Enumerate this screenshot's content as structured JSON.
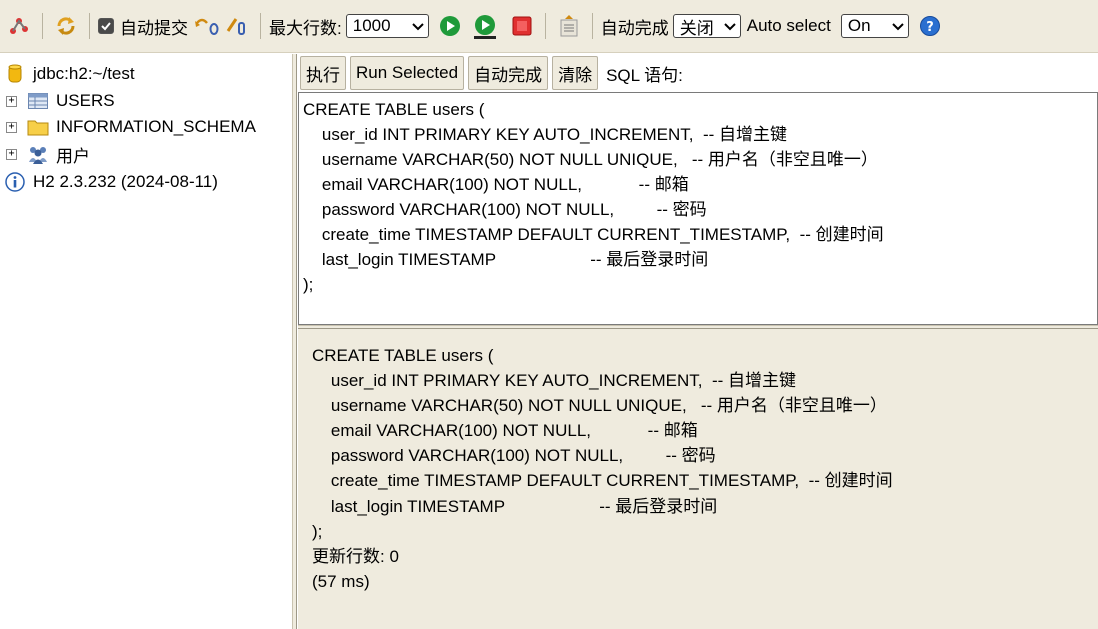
{
  "toolbar": {
    "autocommit_label": "自动提交",
    "max_rows_label": "最大行数:",
    "max_rows_value": "1000",
    "autocomplete_label": "自动完成",
    "autocomplete_value": "关闭",
    "autoselect_label": "Auto select",
    "autoselect_value": "On",
    "icons": [
      "disconnect-icon",
      "refresh-icon",
      "rollback-icon",
      "commit-icon",
      "run-icon",
      "run-selected-icon",
      "stop-icon",
      "history-icon",
      "help-icon"
    ]
  },
  "tree": {
    "connection": "jdbc:h2:~/test",
    "items": [
      {
        "label": "USERS",
        "icon": "table-icon"
      },
      {
        "label": "INFORMATION_SCHEMA",
        "icon": "folder-icon"
      },
      {
        "label": "用户",
        "icon": "users-icon"
      }
    ],
    "version": "H2 2.3.232 (2024-08-11)"
  },
  "query": {
    "buttons": {
      "execute": "执行",
      "run_selected": "Run Selected",
      "autocomplete": "自动完成",
      "clear": "清除"
    },
    "sql_label": "SQL 语句:",
    "lines": [
      "CREATE TABLE users (",
      "    user_id INT PRIMARY KEY AUTO_INCREMENT,  -- 自增主键",
      "    username VARCHAR(50) NOT NULL UNIQUE,   -- 用户名（非空且唯一）",
      "    email VARCHAR(100) NOT NULL,            -- 邮箱",
      "    password VARCHAR(100) NOT NULL,         -- 密码",
      "    create_time TIMESTAMP DEFAULT CURRENT_TIMESTAMP,  -- 创建时间",
      "    last_login TIMESTAMP                    -- 最后登录时间",
      ");"
    ]
  },
  "result": {
    "lines": [
      "CREATE TABLE users (",
      "    user_id INT PRIMARY KEY AUTO_INCREMENT,  -- 自增主键",
      "    username VARCHAR(50) NOT NULL UNIQUE,   -- 用户名（非空且唯一）",
      "    email VARCHAR(100) NOT NULL,            -- 邮箱",
      "    password VARCHAR(100) NOT NULL,         -- 密码",
      "    create_time TIMESTAMP DEFAULT CURRENT_TIMESTAMP,  -- 创建时间",
      "    last_login TIMESTAMP                    -- 最后登录时间",
      ");"
    ],
    "update_count": "更新行数: 0",
    "time": "(57 ms)"
  }
}
